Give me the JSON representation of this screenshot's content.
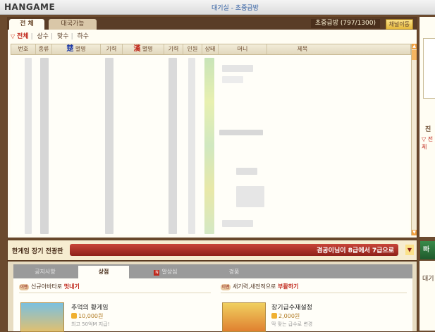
{
  "app": {
    "logo": "HANGAME",
    "window_title": "대기실 - 초중급방"
  },
  "room": {
    "tab_all": "전 체",
    "tab_available": "대국가능",
    "room_info": "초중급방 (797/1300)",
    "channel_button": "채널이동"
  },
  "filters": {
    "all": "전체",
    "sangsu": "상수",
    "matsu": "맞수",
    "hasu": "하수"
  },
  "table": {
    "columns": {
      "number": "번호",
      "type": "종류",
      "han_blue": "楚",
      "nickname1": "별명",
      "rank1": "기력",
      "han_red": "漢",
      "nickname2": "별명",
      "rank2": "기력",
      "players": "인원",
      "status": "상태",
      "money": "머니",
      "title": "제목"
    }
  },
  "shout": {
    "label": "한게임 장기 전광판",
    "message": "겸공이님이 8급에서 7급으로"
  },
  "bottom": {
    "tabs": {
      "notice": "공지사항",
      "shop": "상점",
      "alsangsim": "알상심",
      "gyeongpum": "경품"
    },
    "promo_left": {
      "icon": "이벤",
      "prefix": "신규아바타로",
      "highlight": "멋내기"
    },
    "promo_right": {
      "icon": "이벤",
      "prefix": "새기력,새전적으로",
      "highlight": "부활하기"
    },
    "item_left": {
      "title": "추억의 황게임",
      "price": "10,000원",
      "desc": "최고 50억M 지급!"
    },
    "item_right": {
      "title": "장기급수재설정",
      "price": "2,000원",
      "desc": "딱 맞는 급수로 변경"
    }
  },
  "side": {
    "right_top": "진",
    "right_sub": "▽ 전체",
    "right_button": "빠",
    "right_bottom": "대기"
  }
}
